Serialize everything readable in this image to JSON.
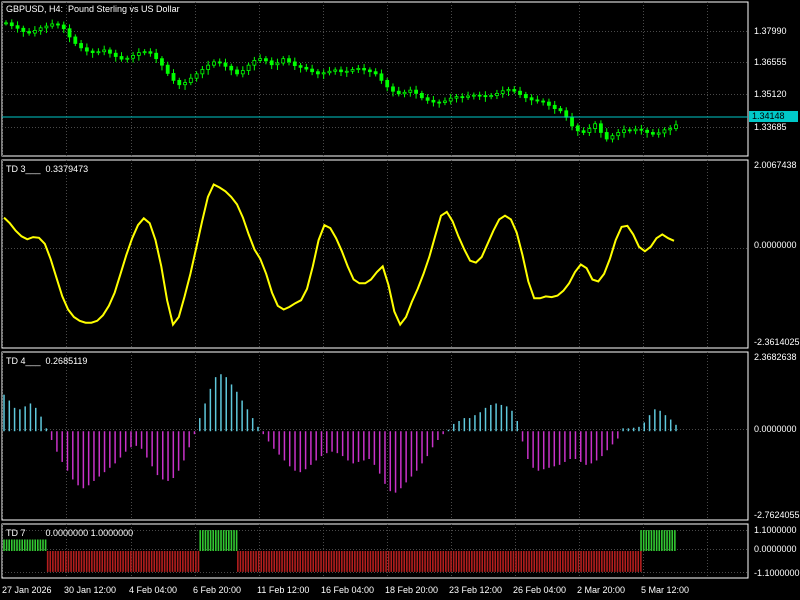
{
  "chart_data": [
    {
      "type": "candlestick",
      "title": "GBPUSD, H4:  Pound Sterling vs US Dollar",
      "y_ticks": [
        "1.37990",
        "1.36555",
        "1.35120",
        "1.33685"
      ],
      "ylim": [
        1.329,
        1.3935
      ],
      "current_price_label": "1.34148",
      "current_price": 1.34148,
      "closes": [
        1.3885,
        1.3872,
        1.386,
        1.3845,
        1.3838,
        1.385,
        1.3862,
        1.387,
        1.388,
        1.3875,
        1.3858,
        1.382,
        1.379,
        1.377,
        1.3755,
        1.3748,
        1.3752,
        1.376,
        1.3745,
        1.373,
        1.3718,
        1.3722,
        1.3735,
        1.3748,
        1.3752,
        1.3745,
        1.372,
        1.369,
        1.3652,
        1.362,
        1.36,
        1.361,
        1.363,
        1.365,
        1.367,
        1.369,
        1.3705,
        1.37,
        1.3685,
        1.3668,
        1.365,
        1.3665,
        1.369,
        1.3712,
        1.372,
        1.371,
        1.3692,
        1.37,
        1.372,
        1.3705,
        1.3688,
        1.368,
        1.3672,
        1.366,
        1.365,
        1.3655,
        1.3662,
        1.3668,
        1.366,
        1.3662,
        1.367,
        1.3675,
        1.3668,
        1.366,
        1.365,
        1.362,
        1.359,
        1.357,
        1.3558,
        1.3565,
        1.3575,
        1.356,
        1.354,
        1.3528,
        1.352,
        1.3518,
        1.3525,
        1.3538,
        1.3545,
        1.3542,
        1.3548,
        1.3552,
        1.355,
        1.3545,
        1.355,
        1.356,
        1.3572,
        1.3578,
        1.357,
        1.3555,
        1.354,
        1.353,
        1.3525,
        1.352,
        1.3505,
        1.349,
        1.348,
        1.345,
        1.341,
        1.3388,
        1.338,
        1.3398,
        1.342,
        1.338,
        1.335,
        1.3365,
        1.338,
        1.3392,
        1.3388,
        1.3395,
        1.339,
        1.338,
        1.3372,
        1.3378,
        1.3392,
        1.3398,
        1.3415
      ],
      "series_color": "#00ff00"
    },
    {
      "type": "line",
      "label": "TD 3___",
      "value_label": "0.3379473",
      "y_ticks": [
        "2.0067438",
        "0.0000000",
        "-2.3614025"
      ],
      "ylim": [
        -2.3614025,
        2.0067438
      ],
      "color": "#ffff00",
      "values": [
        0.9,
        0.75,
        0.55,
        0.4,
        0.32,
        0.38,
        0.36,
        0.2,
        -0.2,
        -0.7,
        -1.2,
        -1.55,
        -1.75,
        -1.85,
        -1.9,
        -1.9,
        -1.85,
        -1.7,
        -1.45,
        -1.1,
        -0.6,
        -0.1,
        0.35,
        0.7,
        0.88,
        0.75,
        0.3,
        -0.4,
        -1.3,
        -1.95,
        -1.75,
        -1.2,
        -0.6,
        0.1,
        0.8,
        1.45,
        1.78,
        1.7,
        1.6,
        1.45,
        1.25,
        0.9,
        0.45,
        0.05,
        -0.2,
        -0.6,
        -1.1,
        -1.45,
        -1.55,
        -1.48,
        -1.38,
        -1.3,
        -1.0,
        -0.4,
        0.3,
        0.7,
        0.62,
        0.35,
        0.0,
        -0.4,
        -0.75,
        -0.85,
        -0.85,
        -0.75,
        -0.55,
        -0.4,
        -0.9,
        -1.6,
        -1.95,
        -1.75,
        -1.35,
        -1.0,
        -0.6,
        -0.15,
        0.4,
        0.95,
        1.05,
        0.8,
        0.4,
        0.05,
        -0.25,
        -0.3,
        -0.15,
        0.2,
        0.55,
        0.85,
        0.95,
        0.85,
        0.5,
        -0.1,
        -0.8,
        -1.25,
        -1.25,
        -1.2,
        -1.22,
        -1.18,
        -1.05,
        -0.85,
        -0.55,
        -0.35,
        -0.45,
        -0.75,
        -0.8,
        -0.6,
        -0.2,
        0.3,
        0.65,
        0.68,
        0.45,
        0.12,
        0.0,
        0.12,
        0.35,
        0.45,
        0.35,
        0.28
      ]
    },
    {
      "type": "histogram",
      "label": "TD 4___",
      "value_label": "0.2685119",
      "y_ticks": [
        "2.3682638",
        "0.0000000",
        "-2.7624055"
      ],
      "ylim": [
        -2.7624055,
        2.3682638
      ],
      "positive_color": "#5fc8dc",
      "negative_color": "#c832c8",
      "values": [
        1.25,
        1.05,
        0.8,
        0.75,
        0.85,
        0.95,
        0.8,
        0.5,
        0.1,
        -0.3,
        -0.7,
        -1.05,
        -1.35,
        -1.65,
        -1.85,
        -1.95,
        -1.85,
        -1.7,
        -1.55,
        -1.4,
        -1.25,
        -1.1,
        -0.9,
        -0.7,
        -0.55,
        -0.5,
        -0.6,
        -0.9,
        -1.2,
        -1.5,
        -1.65,
        -1.7,
        -1.6,
        -1.35,
        -1.0,
        -0.55,
        -0.1,
        0.45,
        0.95,
        1.45,
        1.85,
        1.95,
        1.85,
        1.6,
        1.35,
        1.05,
        0.75,
        0.45,
        0.15,
        -0.1,
        -0.35,
        -0.6,
        -0.8,
        -1.0,
        -1.2,
        -1.35,
        -1.4,
        -1.3,
        -1.15,
        -1.0,
        -0.85,
        -0.75,
        -0.7,
        -0.75,
        -0.85,
        -1.0,
        -1.1,
        -1.05,
        -1.0,
        -0.95,
        -1.15,
        -1.45,
        -1.8,
        -2.05,
        -2.1,
        -1.95,
        -1.75,
        -1.55,
        -1.35,
        -1.1,
        -0.85,
        -0.55,
        -0.3,
        -0.1,
        0.05,
        0.25,
        0.35,
        0.45,
        0.45,
        0.55,
        0.65,
        0.8,
        0.9,
        0.95,
        0.9,
        0.85,
        0.7,
        0.35,
        -0.35,
        -0.95,
        -1.25,
        -1.35,
        -1.3,
        -1.25,
        -1.2,
        -1.15,
        -1.05,
        -0.95,
        -0.95,
        -1.05,
        -1.15,
        -1.1,
        -1.0,
        -0.85,
        -0.65,
        -0.45,
        -0.25,
        0.1,
        0.1,
        0.12,
        0.15,
        0.3,
        0.55,
        0.75,
        0.7,
        0.55,
        0.4,
        0.22
      ]
    },
    {
      "type": "histogram",
      "label": "TD 7",
      "value_label": "0.0000000 1.0000000",
      "y_ticks": [
        "1.1000000",
        "0.0000000",
        "-1.1000000"
      ],
      "ylim": [
        -1.1,
        1.1
      ],
      "positive_color": "#32c832",
      "negative_color": "#b41e1e",
      "segments": [
        {
          "from": 0.0,
          "to": 0.065,
          "value": 0.55
        },
        {
          "from": 0.065,
          "to": 0.292,
          "value": -1.0
        },
        {
          "from": 0.292,
          "to": 0.348,
          "value": 1.0
        },
        {
          "from": 0.348,
          "to": 0.948,
          "value": -1.0
        },
        {
          "from": 0.948,
          "to": 1.0,
          "value": 1.0
        }
      ]
    }
  ],
  "x_labels": [
    "27 Jan 2026",
    "30 Jan 12:00",
    "4 Feb 04:00",
    "6 Feb 20:00",
    "11 Feb 12:00",
    "16 Feb 04:00",
    "18 Feb 20:00",
    "23 Feb 12:00",
    "26 Feb 04:00",
    "2 Mar 20:00",
    "5 Mar 12:00"
  ],
  "grid": true
}
